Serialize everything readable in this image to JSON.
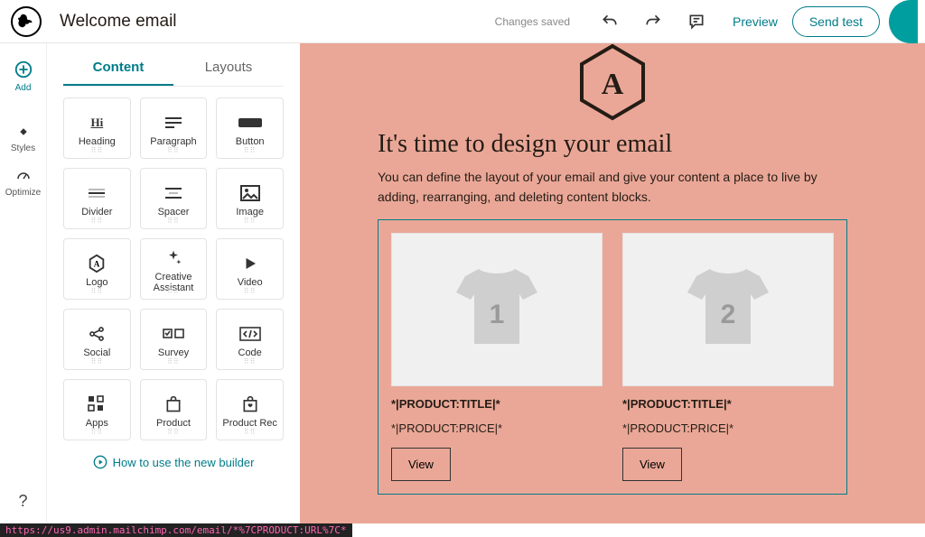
{
  "topbar": {
    "doc_title": "Welcome email",
    "save_status": "Changes saved",
    "preview": "Preview",
    "send_test": "Send test"
  },
  "rail": {
    "add": "Add",
    "styles": "Styles",
    "optimize": "Optimize",
    "help": "?"
  },
  "panel": {
    "tab_content": "Content",
    "tab_layouts": "Layouts",
    "howto": "How to use the new builder",
    "blocks": {
      "heading": "Heading",
      "paragraph": "Paragraph",
      "button": "Button",
      "divider": "Divider",
      "spacer": "Spacer",
      "image": "Image",
      "logo": "Logo",
      "creative": "Creative Assistant",
      "video": "Video",
      "social": "Social",
      "survey": "Survey",
      "code": "Code",
      "apps": "Apps",
      "product": "Product",
      "product_rec": "Product Rec"
    },
    "hi_glyph": "Hi"
  },
  "canvas": {
    "logo_letter": "A",
    "title": "It's time to design your email",
    "description": "You can define the layout of your email and give your content a place to live by adding, rearranging, and deleting content blocks.",
    "products": [
      {
        "num": "1",
        "title": "*|PRODUCT:TITLE|*",
        "price": "*|PRODUCT:PRICE|*",
        "view": "View"
      },
      {
        "num": "2",
        "title": "*|PRODUCT:TITLE|*",
        "price": "*|PRODUCT:PRICE|*",
        "view": "View"
      }
    ]
  },
  "status_url": "https://us9.admin.mailchimp.com/email/*%7CPRODUCT:URL%7C*"
}
